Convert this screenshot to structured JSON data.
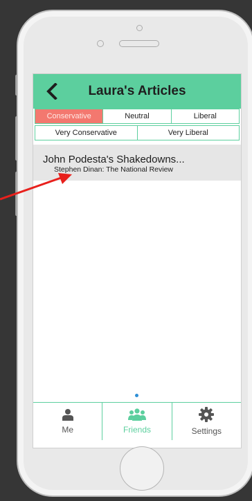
{
  "header": {
    "title": "Laura's Articles"
  },
  "filters": {
    "row1": [
      "Conservative",
      "Neutral",
      "Liberal"
    ],
    "row2": [
      "Very Conservative",
      "Very Liberal"
    ],
    "selected": "Conservative"
  },
  "articles": [
    {
      "title": "John Podesta's Shakedowns...",
      "source": "Stephen Dinan: The National Review"
    }
  ],
  "tabbar": {
    "items": [
      {
        "label": "Me",
        "icon": "person-icon"
      },
      {
        "label": "Friends",
        "icon": "group-icon"
      },
      {
        "label": "Settings",
        "icon": "gear-icon"
      }
    ],
    "active": "Friends"
  },
  "colors": {
    "accent": "#5ccf9e",
    "selected_filter": "#f3786f",
    "annotation_arrow": "#e8201c",
    "page_dot": "#2e8fd6"
  }
}
